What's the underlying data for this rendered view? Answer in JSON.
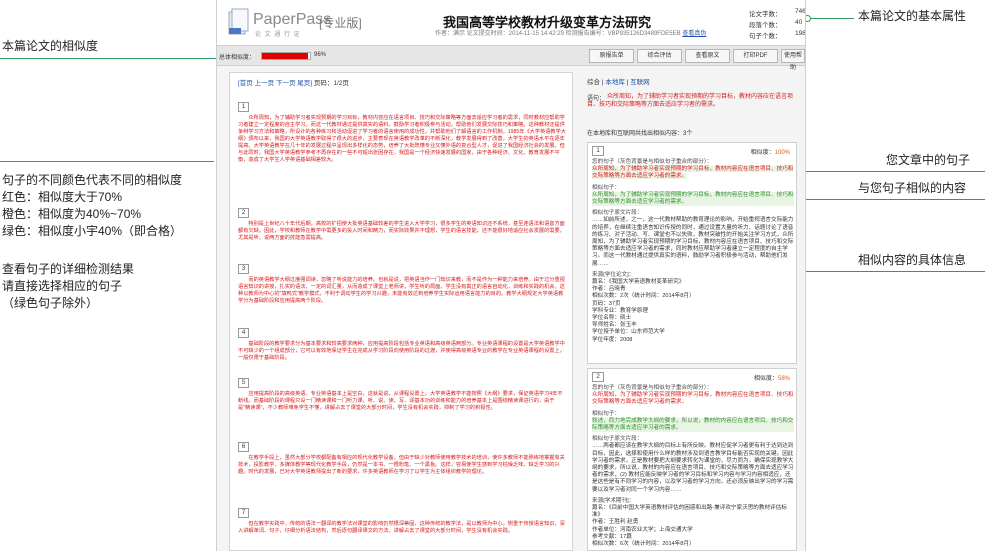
{
  "annotations": {
    "left_similarity": "本篇论文的相似度",
    "color_legend": [
      "句子的不同颜色代表不同的相似度",
      "红色：相似度大于70%",
      "橙色：相似度为40%~70%",
      "绿色：相似度小宇40%（即合格）"
    ],
    "detail_hint": [
      "查看句子的详细检测结果",
      "请直接选择相应的句子",
      "（绿色句子除外）"
    ],
    "right_basic": "本篇论文的基本属性",
    "right_your_sentence": "您文章中的句子",
    "right_similar": "与您句子相似的内容",
    "right_info": "相似内容的具体信息"
  },
  "header": {
    "logo": "PaperPass",
    "version": "[专业版]",
    "logo_sub": "论 文 通 行 证",
    "title": "我国高等学校教材升级变革方法研究",
    "meta": "作者：满示  论文提交时间：2014-11-15 14:42:29  检测报告编号：VBP935126D3489FDE5EB",
    "meta_link": "查看真伪",
    "stats": [
      {
        "label": "论文字数：",
        "value": "7465"
      },
      {
        "label": "段落个数：",
        "value": "40"
      },
      {
        "label": "句子个数：",
        "value": "198"
      }
    ]
  },
  "toolbar": {
    "sim_label": "总体相似度：",
    "sim_value": "96%",
    "sim_fraction": 0.96,
    "buttons": [
      "原报告单",
      "综合评估",
      "查看原文",
      "打印PDF",
      "使用帮助"
    ]
  },
  "left": {
    "nav": [
      "[首页",
      "上一页",
      "下一页",
      "尾页]"
    ],
    "page": "页码：1/2页",
    "paragraphs": [
      {
        "num": "1",
        "text": "众所周知，为了辅助学习者实现预期的学习目标，教材内容应在语言项目、技巧和交际策略等方面去适应学习者的需求，同时教材应帮助学习者建立一定程度的自主学习。而这一代教材通过提供真实的语料，鼓励学习者积极参与活动，帮助他们发展交际技巧和策略。这种教材还提供争辩学习方法和策略，所设计的各种练习和活动促进了学习者的语言使用的成功性，并帮助他们了解语言的工作机制。1985年《大学英语教学大纲》颁布以来，我国的大学英语教学取得了很大的进步，主要表现在英语教学改革的不断深化，教学发展得到了改善，大学生的英语水平在逐年提高。大学英语教学在几十年的发展过程中呈现出多样化的态势，培养了大批既懂专业又懂外语的复合型人才，促进了我国经济社会的发展。但与此同时，我国大学英语教学参考不再存在的一些不可超出张困存在，我国是一个经济快速发展的国家，由于各种经济、文化、教育发展不平衡，造成了大学生人学英语基础相差较大。"
      },
      {
        "num": "2",
        "text": "特别是上世纪八十年代后期，高校的扩招使大批英语基础较差的学生进入大学学习，很多学生的英语知识还不系统，甚至连语法和语音方面都有欠缺。因此，学校和教师在教学中需更多的投入时间和精力，而实际效果并不理想，学生的语言技能、还不能很好地适应社会发展的需要，尤其是听、说两方面的技能急需提高。"
      },
      {
        "num": "3",
        "text": "而的英语教学大纲过度强调读，忽略了听说能力的培养。也就是说，把英语当作一门知识来教，而不是作为一种能力来培养。由于过分重视语言知识的讲授，扎实的语法、一定的词汇量，从而造成了课堂上老师讲，学生听的局面，学生没有真正的语言自动化，训练和实践的机会。这种以教师为中心的\"填鸭式\"教学模式，不利于调动学生的学习兴趣，未能有效达到培养学生实际运用语言能力的目的。教学大纲规定大学英语教学分为基础阶段和应用提高两个阶段。"
      },
      {
        "num": "4",
        "text": "基础阶段的教学要求分为基本要求和较高要求两种，应用提高阶段包括专业英语和高级英语两部分。专业英语课程的设置是大学英语教学中不可缺少的一个组成部分，它可以有效地保证学生在完成从学习阶段向使用阶段的过渡，并使得高级英语专业的教学在专业英语课程的设置上，一般仅限于基础阶段。"
      },
      {
        "num": "5",
        "text": "应用提高阶段的高级英语、专业英语基本上是空白，这就是说，从课程设置上，大学英语教学不能按照《大纲》要求，保证英语学习4年不断线。而基础阶段的课程只设一门精读课和一门听力课，听、说、读、写、译基本功的训练和能力的培养基本上是围绕精读课进行的，由于是\"精读课\"，不少教师难免学生不懂，讲解占去了课堂的大部分时间，学生没有机会实践，抑制了学习的积极性。"
      },
      {
        "num": "6",
        "text": "在教学手段上，虽然大部分学校都配备有相应的现代化教学设备，但由于缺少对教师使用教学技术的培训，使许多教师不能熟练地掌握有关技术，投影教学、多媒体教学等现代化教学手段，仍然是一本书、一根粉笔、一个黑板。这样，容易使学生感到学习枯燥乏味，缺乏学习的兴趣。时代的发展，已对大学英语教师提出了新的要求，许多英语教师在学习了以学生为主体组织教学的理论。"
      },
      {
        "num": "7",
        "text": "但在教学实践中，传统的语法一翻译的教学法对课堂的影响仍然根深蒂固，这种传统的教学法，是以教师为中心，侧重于传授语言知识，深入讲解单词、句子，仔细分析语法结构，然后逐句翻译课文的方法。讲解占去了课堂的大部分时间，学生没有机会实践。"
      }
    ]
  },
  "right": {
    "tabs": [
      "综合",
      "本地库",
      "互联网"
    ],
    "src_prefix": "语句：",
    "src_text": "众所周知，为了辅助学习者实现预期的学习目标，教材内容应在语言项目、技巧和交际策略等方面去适应学习者的需求。",
    "found": "在本地库和互联网共找出相似内容：3个",
    "cards": [
      {
        "num": "1",
        "sim_label": "相似度：",
        "sim": "100%",
        "your_label": "您的句子（灰色背景是与相似句子重合的部分）：",
        "your_text": "众所周知，为了辅助学习者实现预期的学习目标，教材内容应在语言项目、技巧和交际策略等方面去适应学习者的需求。",
        "sim_sent_label": "相似句子：",
        "sim_sent": "众所周知，为了辅助学习者实现预期的学习目标，教材内容应在语言项目、技巧和交际策略等方面去适应学习者的需求。",
        "orig_label": "相似句子原文片段：",
        "orig": "……如前所述，之一，这一代教材帮助的教育理论的影响，开始重视语言交际能力的培养，在继续注重语言知识传授的同时，通过设置大量的听力、话题讨论了语音的练习、对子活动、写、课堂也不以失败，教材突破性的开始关注学习方式，众所周知，为了辅助学习者实现预期的学习目标，教材内容应在语言项目、技巧和交际策略等方面去适应学习者的需求，同时教材应帮助学习者建立一定程度的自主学习。而这一代教材通过提供真实的语料，鼓励学习者积极参与活动，帮助他们发展……",
        "source_label": "来源[学位论文]：",
        "source": [
          "篇名：《我国大学英语教材变革研究》",
          "作者：吕晓青",
          "相似次数：2次（统计时间：2014年8月）",
          "页码：37页",
          "学科专业：教育学原理",
          "学位名称：硕士",
          "导师姓名：张玉丰",
          "学位授予单位：山东师范大学",
          "学位年度：2008"
        ]
      },
      {
        "num": "2",
        "sim_label": "相似度：",
        "sim": "58%",
        "your_label": "您的句子（灰色背景是与相似句子重合的部分）：",
        "your_text": "众所周知，为了辅助学习者实现预期的学习目标，教材内容应在语言项目、技巧和交际策略等方面去适应学习者的需求。",
        "sim_sent_label": "相似句子：",
        "sim_sent": "叙述，而力地完成教学大纲的要求，所以说，教材的内容应在语言项目、技巧和交际策略等方面去适应学习者的需求。",
        "orig_label": "相似句子原文片段：",
        "orig": "……两者都应该在教学大纲的目标上有所反映。教材应促学习者更有利于达到达到目标，因此，选择和使用什么样的教材涉及到语言教学目标能否实现的关键。因此学习者的需求，正是教材要把大纲要求转化为课堂的，尽力而为，确保实现教学大纲的要求，所以说，教材的内容应在语言项目、技巧和交际策略等方面去适应学习者的需求，(2) 教材应能反映学习者的学习目标和学习内容与学习内容相适应，还是这些是有不同学习的内容，以及学习者的学习方向，还必须反映出学习的学习需要以及学习者对同一个学习内容……",
        "source_label": "来源[学术期刊]：",
        "source": [
          "篇名：《目前中国大学英语教材评估的困惑和出路-兼评欢宁家沃思的教材评估标准》",
          "作者：王胜利 赵勇",
          "作者单位：河南农业大学；上海交通大学",
          "参考文献：17篇",
          "相似次数：6次（统计时间：2014年8月）"
        ]
      }
    ]
  }
}
